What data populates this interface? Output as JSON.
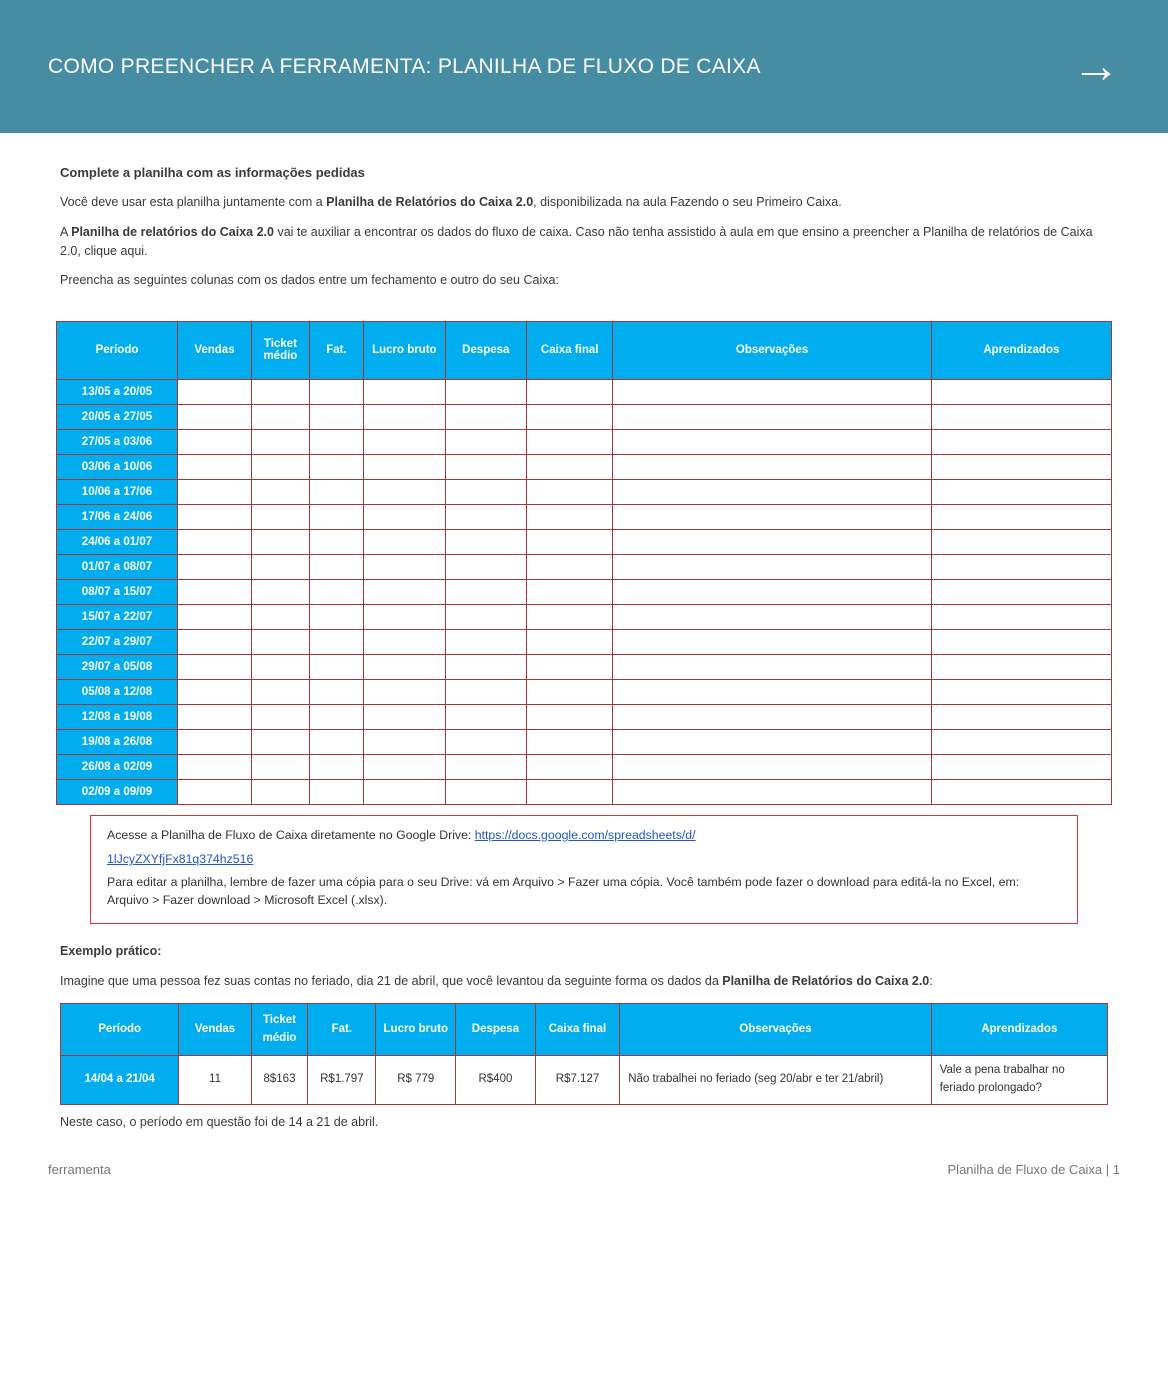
{
  "header": {
    "title": "COMO PREENCHER A FERRAMENTA: PLANILHA DE FLUXO DE CAIXA",
    "arrow": "→"
  },
  "intro": {
    "heading": "Complete a planilha com as informações pedidas",
    "p1_a": "Você deve usar esta planilha juntamente com a ",
    "p1_b": "Planilha de Relatórios do Caixa 2.0",
    "p1_c": ", disponibilizada na aula Fazendo o seu Primeiro Caixa.",
    "p2_a": "A ",
    "p2_b": "Planilha de relatórios do Caixa 2.0",
    "p2_c": " vai te auxiliar a encontrar os dados do fluxo de caixa. Caso não tenha assistido à aula em que ensino a preencher a Planilha de relatórios de Caixa 2.0, clique aqui.",
    "p3": "Preencha as seguintes colunas com os dados entre um fechamento e outro do seu Caixa:"
  },
  "table": {
    "headers": [
      "Período",
      "Vendas",
      "Ticket médio",
      "Fat.",
      "Lucro bruto",
      "Despesa",
      "Caixa final",
      "Observações",
      "Aprendizados"
    ],
    "rows": [
      {
        "periodo": "13/05 a 20/05",
        "vendas": "",
        "ticket": "",
        "fat": "",
        "lucro": "",
        "despesa": "",
        "caixa": "",
        "obs": "",
        "apr": ""
      },
      {
        "periodo": "20/05 a 27/05",
        "vendas": "",
        "ticket": "",
        "fat": "",
        "lucro": "",
        "despesa": "",
        "caixa": "",
        "obs": "",
        "apr": ""
      },
      {
        "periodo": "27/05 a 03/06",
        "vendas": "",
        "ticket": "",
        "fat": "",
        "lucro": "",
        "despesa": "",
        "caixa": "",
        "obs": "",
        "apr": ""
      },
      {
        "periodo": "03/06 a 10/06",
        "vendas": "",
        "ticket": "",
        "fat": "",
        "lucro": "",
        "despesa": "",
        "caixa": "",
        "obs": "",
        "apr": ""
      },
      {
        "periodo": "10/06 a 17/06",
        "vendas": "",
        "ticket": "",
        "fat": "",
        "lucro": "",
        "despesa": "",
        "caixa": "",
        "obs": "",
        "apr": ""
      },
      {
        "periodo": "17/06 a 24/06",
        "vendas": "",
        "ticket": "",
        "fat": "",
        "lucro": "",
        "despesa": "",
        "caixa": "",
        "obs": "",
        "apr": ""
      },
      {
        "periodo": "24/06 a 01/07",
        "vendas": "",
        "ticket": "",
        "fat": "",
        "lucro": "",
        "despesa": "",
        "caixa": "",
        "obs": "",
        "apr": ""
      },
      {
        "periodo": "01/07 a 08/07",
        "vendas": "",
        "ticket": "",
        "fat": "",
        "lucro": "",
        "despesa": "",
        "caixa": "",
        "obs": "",
        "apr": ""
      },
      {
        "periodo": "08/07 a 15/07",
        "vendas": "",
        "ticket": "",
        "fat": "",
        "lucro": "",
        "despesa": "",
        "caixa": "",
        "obs": "",
        "apr": ""
      },
      {
        "periodo": "15/07 a 22/07",
        "vendas": "",
        "ticket": "",
        "fat": "",
        "lucro": "",
        "despesa": "",
        "caixa": "",
        "obs": "",
        "apr": ""
      },
      {
        "periodo": "22/07 a 29/07",
        "vendas": "",
        "ticket": "",
        "fat": "",
        "lucro": "",
        "despesa": "",
        "caixa": "",
        "obs": "",
        "apr": ""
      },
      {
        "periodo": "29/07 a 05/08",
        "vendas": "",
        "ticket": "",
        "fat": "",
        "lucro": "",
        "despesa": "",
        "caixa": "",
        "obs": "",
        "apr": ""
      },
      {
        "periodo": "05/08 a 12/08",
        "vendas": "",
        "ticket": "",
        "fat": "",
        "lucro": "",
        "despesa": "",
        "caixa": "",
        "obs": "",
        "apr": ""
      },
      {
        "periodo": "12/08 a 19/08",
        "vendas": "",
        "ticket": "",
        "fat": "",
        "lucro": "",
        "despesa": "",
        "caixa": "",
        "obs": "",
        "apr": ""
      },
      {
        "periodo": "19/08 a 26/08",
        "vendas": "",
        "ticket": "",
        "fat": "",
        "lucro": "",
        "despesa": "",
        "caixa": "",
        "obs": "",
        "apr": ""
      },
      {
        "periodo": "26/08 a 02/09",
        "vendas": "",
        "ticket": "",
        "fat": "",
        "lucro": "",
        "despesa": "",
        "caixa": "",
        "obs": "",
        "apr": ""
      },
      {
        "periodo": "02/09 a 09/09",
        "vendas": "",
        "ticket": "",
        "fat": "",
        "lucro": "",
        "despesa": "",
        "caixa": "",
        "obs": "",
        "apr": ""
      }
    ]
  },
  "note": {
    "lead_a": "Acesse a Planilha de Fluxo de Caixa diretamente no Google Drive: ",
    "link1_text": "https://docs.google.com/spreadsheets/d/",
    "link2_text": "1lJcyZXYfjFx81q374hz516",
    "follow": "Para editar a planilha, lembre de fazer uma cópia para o seu Drive: vá em Arquivo > Fazer uma cópia. Você também pode fazer o download para editá-la no Excel, em: Arquivo > Fazer download > Microsoft Excel (.xlsx)."
  },
  "example": {
    "heading": "Exemplo prático:",
    "p_a": "Imagine que uma pessoa fez suas contas no feriado, dia 21 de abril, que você levantou da seguinte forma os dados da ",
    "p_b": "Planilha de Relatórios do Caixa 2.0",
    "p_c": ":",
    "headers": [
      "Período",
      "Vendas",
      "Ticket médio",
      "Fat.",
      "Lucro bruto",
      "Despesa",
      "Caixa final",
      "Observações",
      "Aprendizados"
    ],
    "row": {
      "periodo": "14/04 a 21/04",
      "vendas": "11",
      "ticket": "8$163",
      "fat": "R$1.797",
      "lucro": "R$ 779",
      "despesa": "R$400",
      "caixa": "R$7.127",
      "obs": "Não trabalhei no feriado (seg 20/abr e ter 21/abril)",
      "apr": "Vale a pena trabalhar no feriado prolongado?"
    },
    "tail": "Neste caso, o período em questão foi de 14 a 21 de abril."
  },
  "footer": {
    "left": "ferramenta",
    "right": "Planilha de Fluxo de Caixa | 1"
  }
}
